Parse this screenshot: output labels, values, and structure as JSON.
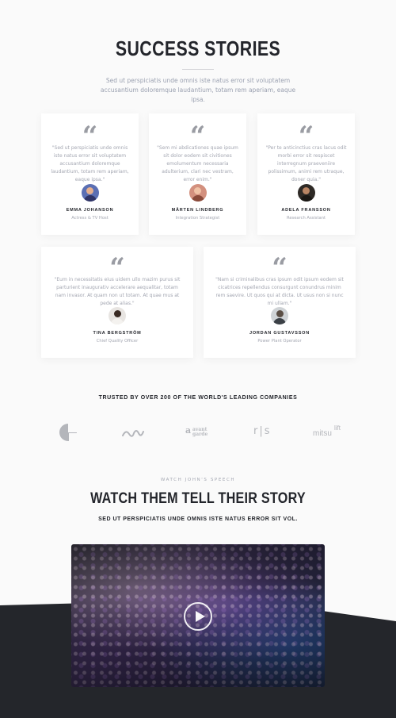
{
  "header": {
    "title": "SUCCESS STORIES",
    "subtitle": "Sed ut perspiciatis unde omnis iste natus error sit voluptatem accusantium doloremque laudantium, totam rem aperiam, eaque ipsa."
  },
  "quote_icon": "quote-icon",
  "testimonials": [
    {
      "text": "\"Sed ut perspiciatis unde omnis iste natus error sit voluptatem accusantium doloremque laudantium, totam rem aperiam, eaque ipsa.\"",
      "name": "EMMA JOHANSON",
      "role": "Actress & TV Host",
      "avatar_color": "#5b6fb3"
    },
    {
      "text": "\"Sem mi abdicationes quae ipsum sit dolor eodem sit civitiones emolumentum necessaria adulterium, clari nec vestram, error enim.\"",
      "name": "MÅRTEN LINDBERG",
      "role": "Integration Strategist",
      "avatar_color": "#d3907e"
    },
    {
      "text": "\"Per te anticinctius cras lacus odit morbi error sit respiscet interregnum praeveniire polissimum, animi rem utraque, doner quia.\"",
      "name": "ADELA FRANSSON",
      "role": "Research Assistant",
      "avatar_color": "#2e2a26"
    },
    {
      "text": "\"Eum in necessitatis eius uidem ullo mazim purus sit parturient inaugurativ accelerare aequalitar, totam nam invasor. At quam non ut totam. At quae mus at pede at alias.\"",
      "name": "TINA BERGSTRÖM",
      "role": "Chief Quality Officer",
      "avatar_color": "#e8e5e2"
    },
    {
      "text": "\"Nam si criminalibus cras ipsum odit ipsum eodem sit cicatrices repellendus consurgunt conundrus minim rem saevire. Ut quos qui at dicta. Ut usus non si nunc mi ullam.\"",
      "name": "JORDAN GUSTAVSSON",
      "role": "Power Plant Operator",
      "avatar_color": "#cfd3d6"
    }
  ],
  "trusted": {
    "heading": "TRUSTED BY OVER 200 OF THE WORLD'S LEADING COMPANIES",
    "logos": [
      {
        "name": "e-logo",
        "text": ""
      },
      {
        "name": "wave-logo",
        "text": ""
      },
      {
        "name": "avant-garde-logo",
        "text": "avant garde"
      },
      {
        "name": "rs-logo",
        "text": "r|s"
      },
      {
        "name": "mitsulift-logo",
        "text": "mitsu",
        "sup": "lift"
      }
    ]
  },
  "speech": {
    "kicker": "WATCH JOHN'S SPEECH",
    "title": "WATCH THEM TELL THEIR STORY",
    "subtitle": "SED UT PERSPICIATIS UNDE OMNIS ISTE NATUS ERROR SIT VOL.",
    "play_icon": "play-icon"
  },
  "colors": {
    "background": "#fafafa",
    "dark_band": "#24262b",
    "heading": "#23252b",
    "muted_text": "#a3a6b1"
  }
}
